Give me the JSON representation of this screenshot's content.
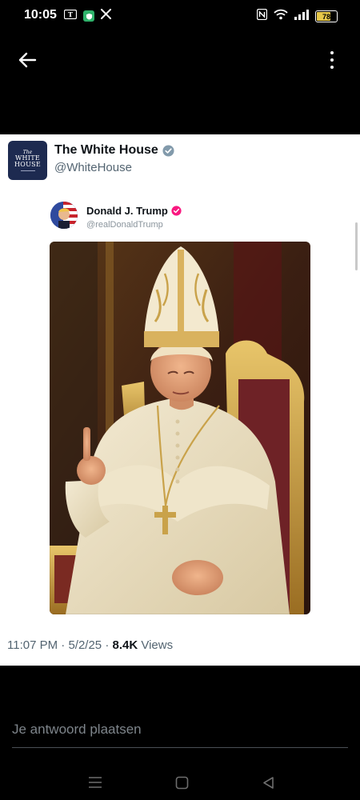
{
  "status_bar": {
    "time": "10:05",
    "battery_level": "78",
    "left_icons": [
      "newspaper-icon",
      "shield-app-icon",
      "x-app-icon"
    ],
    "right_icons": [
      "nfc-icon",
      "wifi-icon",
      "signal-icon",
      "battery-icon"
    ]
  },
  "header": {
    "back_icon": "arrow-left-icon",
    "more_icon": "more-vertical-icon"
  },
  "post": {
    "author_name": "The White House",
    "author_handle": "@WhiteHouse",
    "avatar_text_small": "The",
    "avatar_text_line1": "WHITE",
    "avatar_text_line2": "HOUSE",
    "verified_color": "#829aab",
    "quote": {
      "author_name": "Donald J. Trump",
      "author_handle": "@realDonaldTrump",
      "verified_color": "#f91880"
    },
    "image_description": "pope-portrait-image",
    "timestamp": "11:07 PM",
    "date": "5/2/25",
    "separator": "·",
    "views_count": "8.4K",
    "views_label": "Views"
  },
  "reply": {
    "placeholder": "Je antwoord plaatsen"
  },
  "nav_bar": {
    "icons": [
      "menu-icon",
      "home-square-icon",
      "back-triangle-icon"
    ]
  },
  "colors": {
    "background": "#000000",
    "card": "#ffffff",
    "accent_gold": "#c9a24a"
  }
}
